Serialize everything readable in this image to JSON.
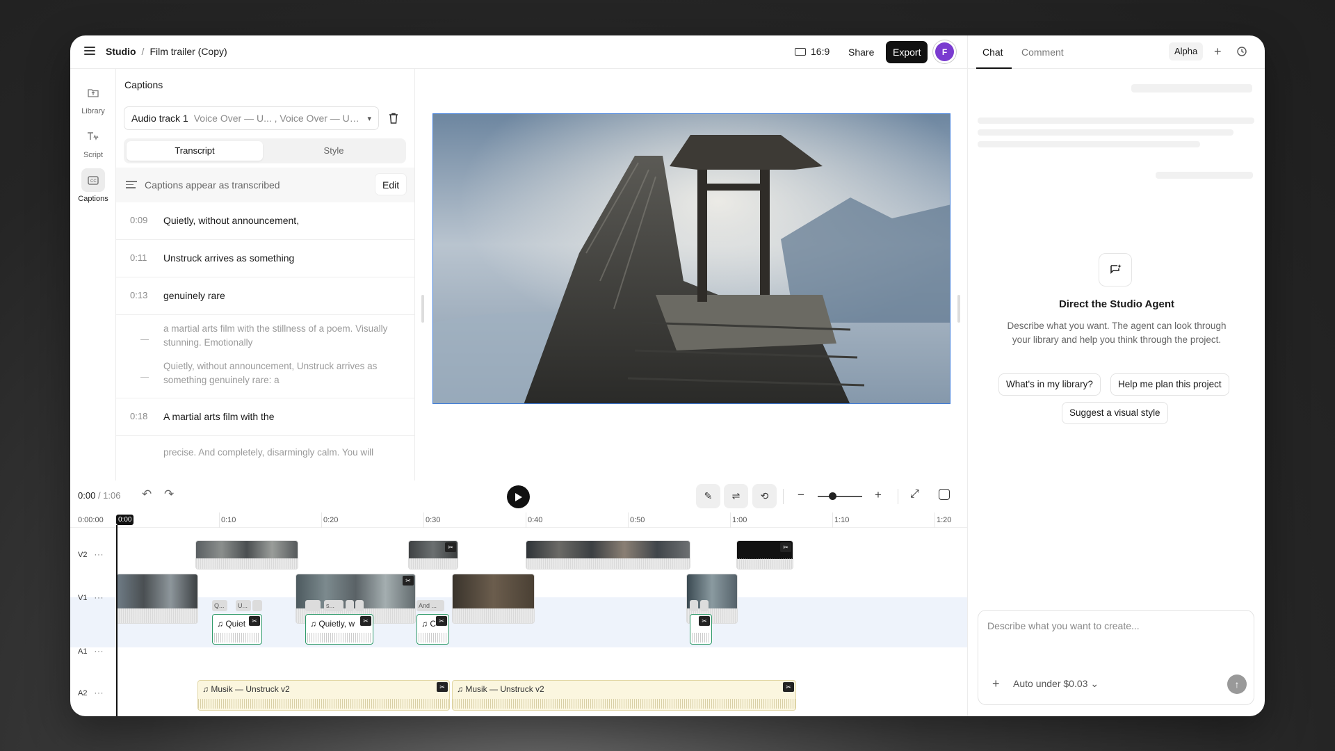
{
  "header": {
    "breadcrumb_home": "Studio",
    "breadcrumb_sep": "/",
    "breadcrumb_project": "Film trailer (Copy)",
    "aspect_ratio": "16:9",
    "share_label": "Share",
    "export_label": "Export",
    "avatar_initial": "F"
  },
  "rail": {
    "items": [
      {
        "label": "Library",
        "icon": "library-icon"
      },
      {
        "label": "Script",
        "icon": "script-icon"
      },
      {
        "label": "Captions",
        "icon": "captions-icon"
      }
    ]
  },
  "captions": {
    "title": "Captions",
    "audio_track": "Audio track 1",
    "audio_sources": "Voice Over — U... , Voice Over — Un...",
    "tabs": [
      "Transcript",
      "Style"
    ],
    "appear_text": "Captions appear as transcribed",
    "edit_label": "Edit",
    "rows": [
      {
        "time": "0:09",
        "text": "Quietly, without announcement,"
      },
      {
        "time": "0:11",
        "text": "Unstruck arrives as something"
      },
      {
        "time": "0:13",
        "text": "genuinely rare"
      },
      {
        "time": "",
        "text": "a martial arts film with the stillness of a poem. Visually stunning. Emotionally"
      },
      {
        "time": "",
        "text": "Quietly, without announcement, Unstruck arrives as something genuinely rare: a"
      },
      {
        "time": "0:18",
        "text": "A martial arts film with the"
      },
      {
        "time": "",
        "text": "precise. And completely, disarmingly calm. You will"
      }
    ]
  },
  "right_panel": {
    "tabs": [
      "Chat",
      "Comment"
    ],
    "badge": "Alpha",
    "agent_title": "Direct the Studio Agent",
    "agent_desc": "Describe what you want. The agent can look through your library and help you think through the project.",
    "suggestions": [
      "What's in my library?",
      "Help me plan this project",
      "Suggest a visual style"
    ],
    "composer_placeholder": "Describe what you want to create...",
    "budget_label": "Auto under $0.03"
  },
  "player": {
    "current_time": "0:00",
    "duration": "/ 1:06"
  },
  "timeline": {
    "ruler_start": "0:00:00",
    "playhead": "0:00",
    "ruler_labels": [
      "0:10",
      "0:20",
      "0:30",
      "0:40",
      "0:50",
      "1:00",
      "1:10",
      "1:20"
    ],
    "tracks": [
      "V2",
      "V1",
      "A1",
      "A2"
    ],
    "a1_clip_labels": [
      "Quiet",
      "Quietly, w",
      "C"
    ],
    "a1_mini_labels": [
      "Q...",
      "U...",
      "s...",
      "And ..."
    ],
    "music_label": "Musik — Unstruck v2"
  }
}
